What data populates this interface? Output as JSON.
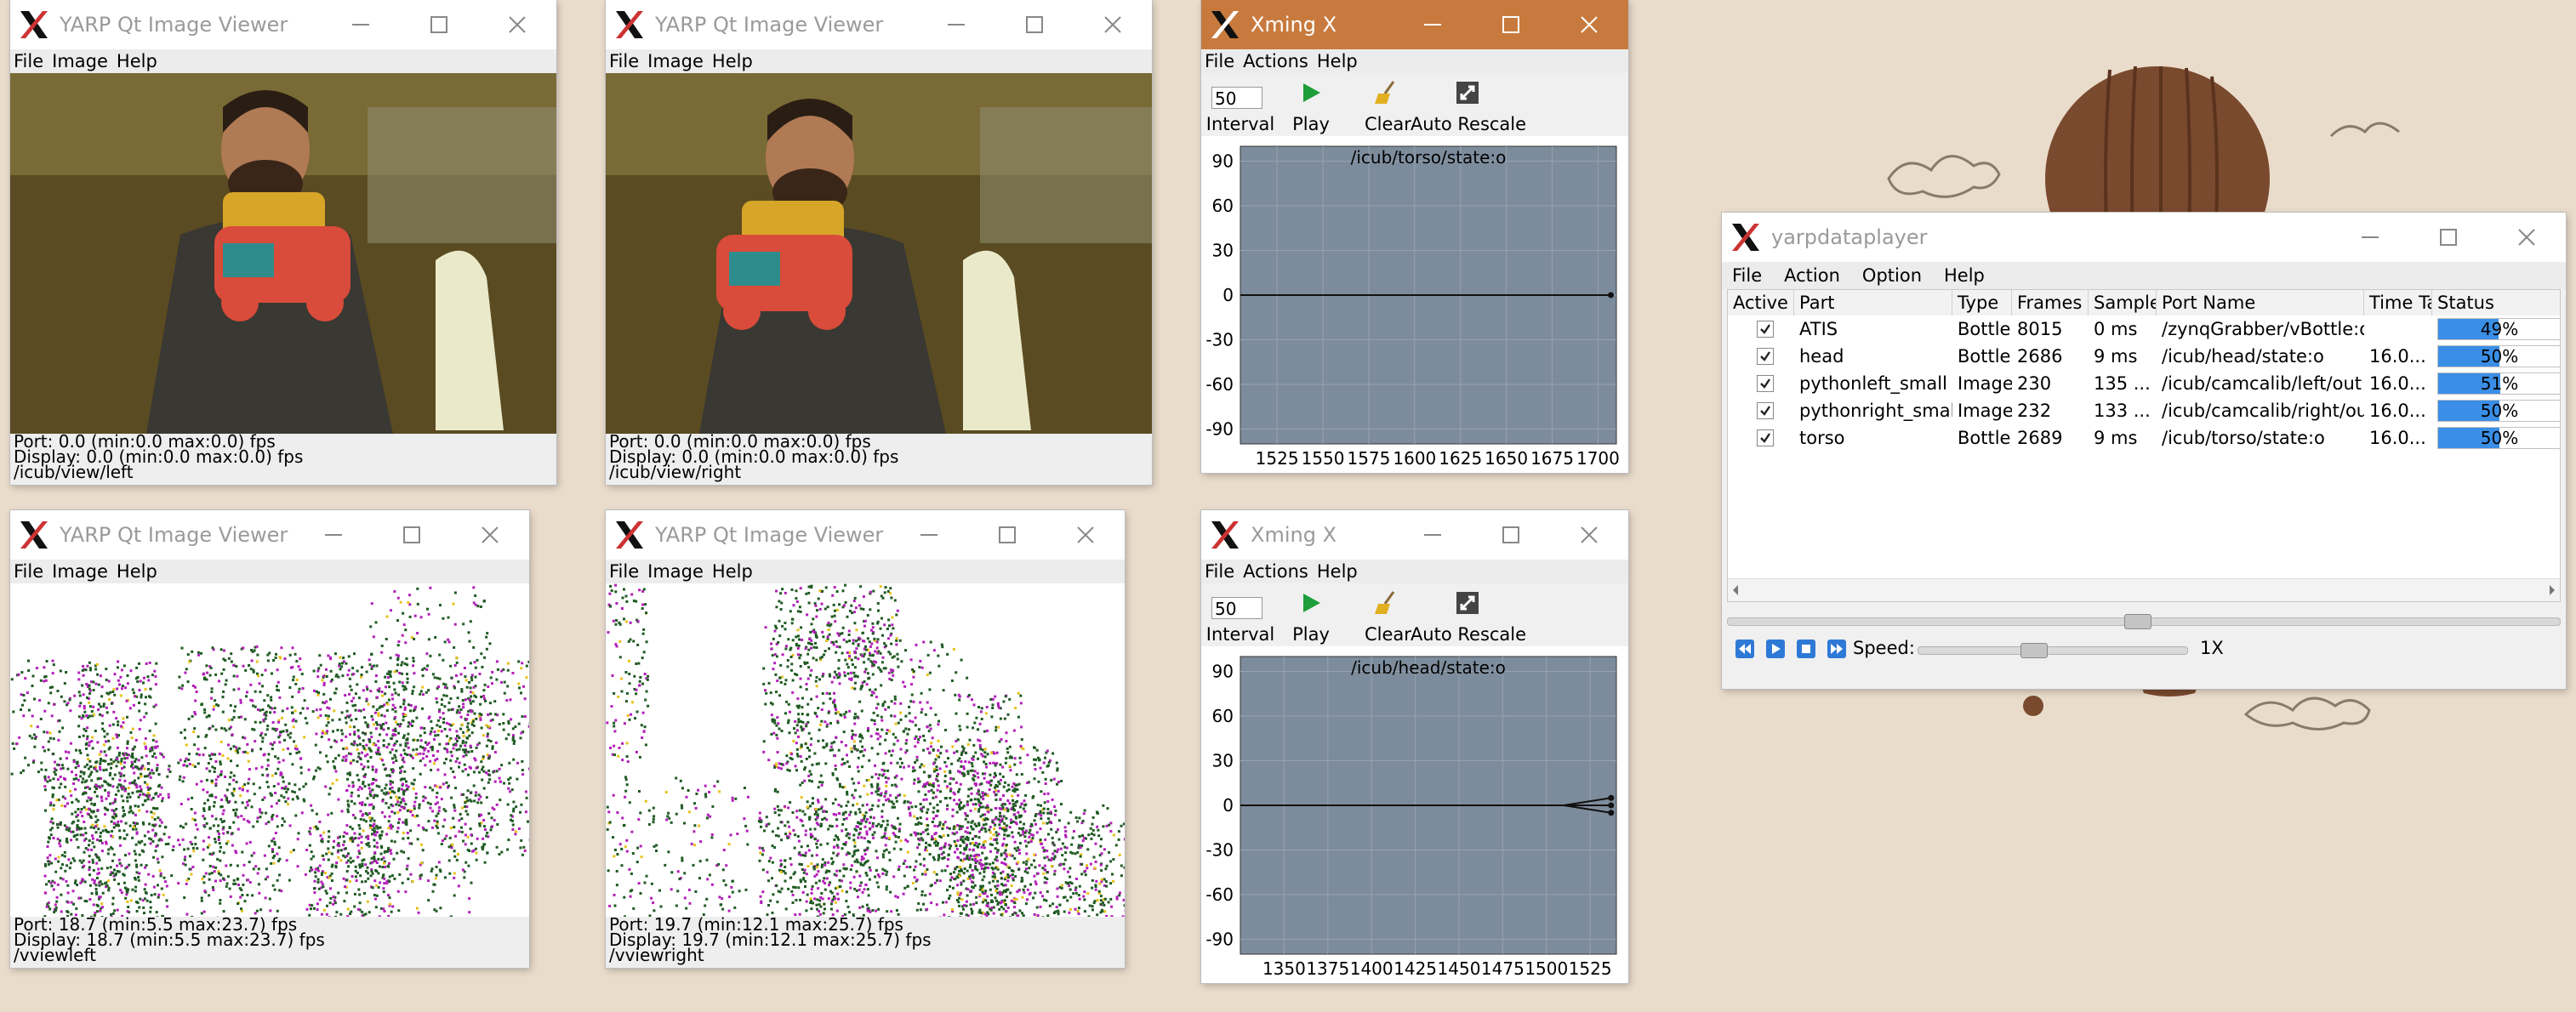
{
  "viewers": [
    {
      "title": "YARP Qt Image Viewer",
      "menu": [
        "File",
        "Image",
        "Help"
      ],
      "port": "Port: 0.0 (min:0.0 max:0.0) fps",
      "display": "Display: 0.0 (min:0.0 max:0.0) fps",
      "name": "/icub/view/left",
      "image": "camera-frame-left"
    },
    {
      "title": "YARP Qt Image Viewer",
      "menu": [
        "File",
        "Image",
        "Help"
      ],
      "port": "Port: 0.0 (min:0.0 max:0.0) fps",
      "display": "Display: 0.0 (min:0.0 max:0.0) fps",
      "name": "/icub/view/right",
      "image": "camera-frame-right"
    },
    {
      "title": "YARP Qt Image Viewer",
      "menu": [
        "File",
        "Image",
        "Help"
      ],
      "port": "Port: 18.7 (min:5.5 max:23.7) fps",
      "display": "Display: 18.7 (min:5.5 max:23.7) fps",
      "name": "/vviewleft",
      "image": "event-frame-left"
    },
    {
      "title": "YARP Qt Image Viewer",
      "menu": [
        "File",
        "Image",
        "Help"
      ],
      "port": "Port: 19.7 (min:12.1 max:25.7) fps",
      "display": "Display: 19.7 (min:12.1 max:25.7) fps",
      "name": "/vviewright",
      "image": "event-frame-right"
    }
  ],
  "xming": [
    {
      "title": "Xming X",
      "menu": [
        "File",
        "Actions",
        "Help"
      ],
      "interval_value": "50",
      "toolbar": {
        "interval": "Interval",
        "play": "Play",
        "clear": "Clear",
        "auto_rescale": "Auto Rescale"
      }
    },
    {
      "title": "Xming X",
      "menu": [
        "File",
        "Actions",
        "Help"
      ],
      "interval_value": "50",
      "toolbar": {
        "interval": "Interval",
        "play": "Play",
        "clear": "Clear",
        "auto_rescale": "Auto Rescale"
      }
    }
  ],
  "chart_data": [
    {
      "type": "line",
      "title": "/icub/torso/state:o",
      "x": [
        1505,
        1710
      ],
      "ylim": [
        -100,
        100
      ],
      "yticks": [
        90,
        60,
        30,
        0,
        -30,
        -60,
        -90
      ],
      "xticks": [
        1525,
        1550,
        1575,
        1600,
        1625,
        1650,
        1675,
        1700
      ],
      "series": [
        {
          "values": [
            0,
            0
          ]
        }
      ],
      "grid": true
    },
    {
      "type": "line",
      "title": "/icub/head/state:o",
      "x": [
        1325,
        1540
      ],
      "ylim": [
        -100,
        100
      ],
      "yticks": [
        90,
        60,
        30,
        0,
        -30,
        -60,
        -90
      ],
      "xticks": [
        1350,
        1375,
        1400,
        1425,
        1450,
        1475,
        1500,
        1525
      ],
      "series": [
        {
          "values": [
            0,
            0
          ]
        },
        {
          "values": [
            0,
            5
          ]
        },
        {
          "values": [
            0,
            -5
          ]
        }
      ],
      "grid": true
    }
  ],
  "player": {
    "title": "yarpdataplayer",
    "menu": [
      "File",
      "Action",
      "Option",
      "Help"
    ],
    "columns": [
      "Active",
      "Part",
      "Type",
      "Frames",
      "Sample",
      "Port Name",
      "Time Ta",
      "Status"
    ],
    "rows": [
      {
        "part": "ATIS",
        "type": "Bottle",
        "frames": "8015",
        "sample": "0 ms",
        "port": "/zynqGrabber/vBottle:o",
        "time": "",
        "status": 49,
        "status_text": "49%"
      },
      {
        "part": "head",
        "type": "Bottle",
        "frames": "2686",
        "sample": "9 ms",
        "port": "/icub/head/state:o",
        "time": "16.0...",
        "status": 50,
        "status_text": "50%"
      },
      {
        "part": "pythonleft_small",
        "type": "Image",
        "frames": "230",
        "sample": "135 ...",
        "port": "/icub/camcalib/left/out",
        "time": "16.0...",
        "status": 51,
        "status_text": "51%"
      },
      {
        "part": "pythonright_small",
        "type": "Image",
        "frames": "232",
        "sample": "133 ...",
        "port": "/icub/camcalib/right/out",
        "time": "16.0...",
        "status": 50,
        "status_text": "50%"
      },
      {
        "part": "torso",
        "type": "Bottle",
        "frames": "2689",
        "sample": "9 ms",
        "port": "/icub/torso/state:o",
        "time": "16.0...",
        "status": 50,
        "status_text": "50%"
      }
    ],
    "speed_label": "Speed:",
    "speed_value": "1X",
    "speed_slider": 0.45
  }
}
